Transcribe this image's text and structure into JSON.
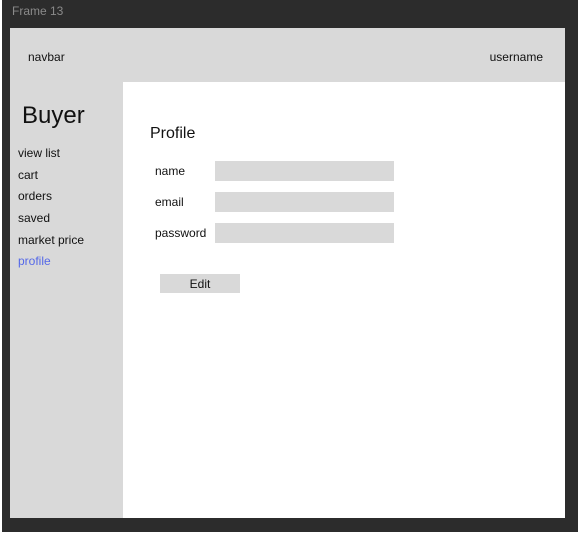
{
  "window": {
    "frame_label": "Frame 13"
  },
  "navbar": {
    "title": "navbar",
    "username": "username"
  },
  "sidebar": {
    "heading": "Buyer",
    "items": [
      {
        "label": "view list"
      },
      {
        "label": "cart"
      },
      {
        "label": "orders"
      },
      {
        "label": "saved"
      },
      {
        "label": "market price"
      },
      {
        "label": "profile",
        "active": true
      }
    ]
  },
  "profile": {
    "title": "Profile",
    "fields": [
      {
        "label": "name",
        "value": ""
      },
      {
        "label": "email",
        "value": ""
      },
      {
        "label": "password",
        "value": ""
      }
    ],
    "edit_label": "Edit"
  },
  "colors": {
    "canvas": "#2c2c2c",
    "panel": "#d9d9d9",
    "active_link": "#5468e8"
  }
}
